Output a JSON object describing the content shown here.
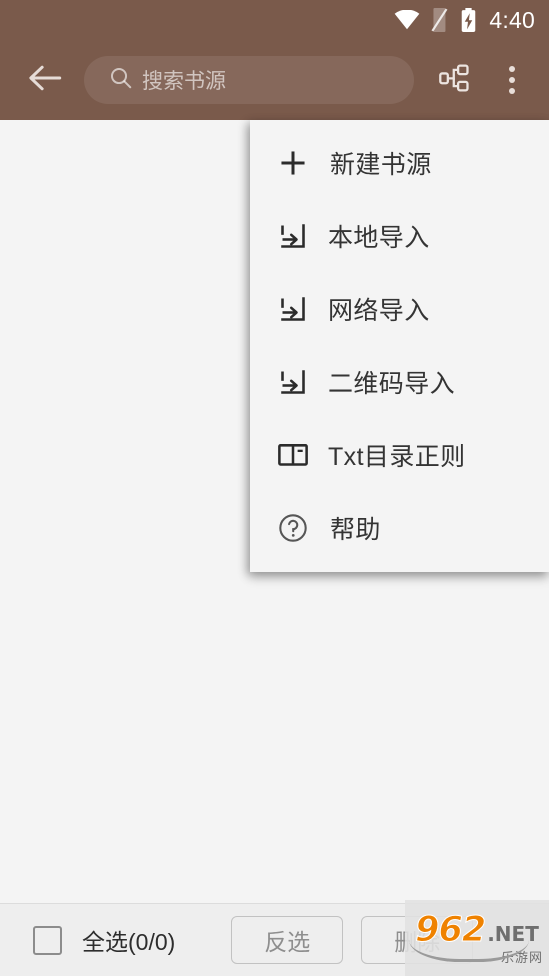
{
  "statusbar": {
    "time": "4:40",
    "icons": [
      "wifi-icon",
      "sim-card-off-icon",
      "battery-charging-icon"
    ]
  },
  "appbar": {
    "back_icon": "arrow-left-icon",
    "search": {
      "icon": "search-icon",
      "placeholder": "搜索书源",
      "value": ""
    },
    "actions": [
      {
        "name": "group-manage-icon",
        "label": "分组"
      },
      {
        "name": "overflow-menu-icon",
        "label": "更多"
      }
    ]
  },
  "menu": {
    "items": [
      {
        "icon": "plus-icon",
        "label": "新建书源"
      },
      {
        "icon": "import-icon",
        "label": "本地导入"
      },
      {
        "icon": "import-icon",
        "label": "网络导入"
      },
      {
        "icon": "import-icon",
        "label": "二维码导入"
      },
      {
        "icon": "book-open-icon",
        "label": "Txt目录正则"
      },
      {
        "icon": "help-circle-icon",
        "label": "帮助"
      }
    ]
  },
  "bottombar": {
    "select_all_label": "全选(0/0)",
    "checkbox_checked": false,
    "invert_label": "反选",
    "delete_label": "删除"
  },
  "watermark": {
    "brand": "962",
    "tld": ".NET",
    "subtitle": "乐游网"
  },
  "colors": {
    "appbar": "#7a5a4b",
    "content_bg": "#f4f4f4",
    "menu_bg": "#f4f4f4",
    "bottombar_bg": "#eeeeee",
    "menu_text": "#343434",
    "disabled_text": "#8e8e8e",
    "watermark_orange": "#ef8200"
  }
}
